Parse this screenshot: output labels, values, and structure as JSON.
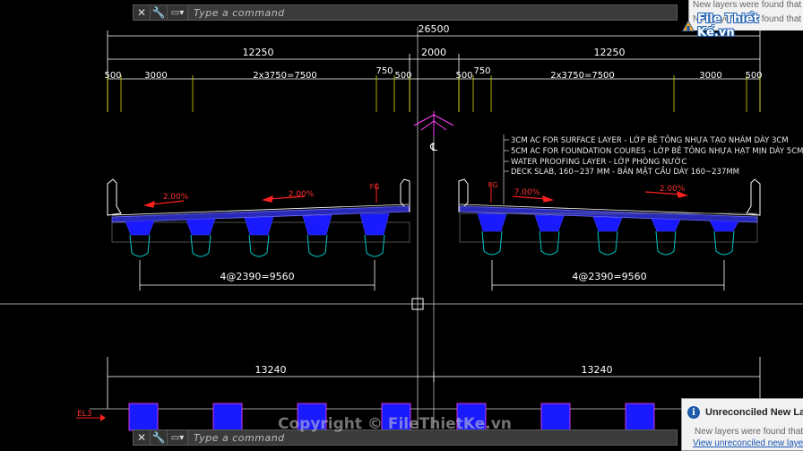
{
  "command_line": {
    "placeholder": "Type a command",
    "close_icon": "close-icon",
    "wrench_icon": "wrench-icon",
    "prompt_icon": "command-prompt-icon"
  },
  "drawing": {
    "overall_width": "26500",
    "half_width_left": "12250",
    "median_width": "2000",
    "half_width_right": "12250",
    "left_segments": [
      "500",
      "3000",
      "2x3750=7500",
      "750",
      "500"
    ],
    "right_segments": [
      "500",
      "750",
      "2x3750=7500",
      "3000",
      "500"
    ],
    "centerline_symbol": "℄",
    "notes": [
      "3CM AC FOR SURFACE LAYER - LỚP BÊ TÔNG NHỰA TẠO NHÁM DÀY 3CM",
      "5CM AC FOR FOUNDATION COURES - LỚP BÊ TÔNG NHỰA HẠT MỊN DÀY 5CM",
      "WATER PROOFING LAYER - LỚP PHÒNG NƯỚC",
      "DECK SLAB, 160~237 MM - BẢN MẶT CẦU DÀY 160~237MM"
    ],
    "slope_labels": [
      "2.00%",
      "2.00%",
      "7.00%",
      "2.00%"
    ],
    "fg_labels": [
      "FG",
      "FG"
    ],
    "girder_spacing_left": "4@2390=9560",
    "girder_spacing_right": "4@2390=9560",
    "pier_width_left": "13240",
    "pier_width_right": "13240",
    "elevation_label": "EL3",
    "colors": {
      "background": "#000000",
      "dimension": "#ffffff",
      "girder": "#1a1aff",
      "bearing": "#00c8c8",
      "slope_arrow": "#ff2020",
      "note_text": "#e8e8e8",
      "centerline": "#ff40ff"
    }
  },
  "notifications": {
    "top_lines": [
      "New layers were found that m",
      "New layers were found that n"
    ],
    "bottom_title": "Unreconciled New Laye",
    "bottom_body": "New layers were found that",
    "bottom_link": "View unreconciled new laye",
    "info_icon": "info-icon"
  },
  "branding": {
    "logo_text": "File Thiết Kế.vn",
    "watermark": "Copyright © FileThietKe.vn"
  }
}
